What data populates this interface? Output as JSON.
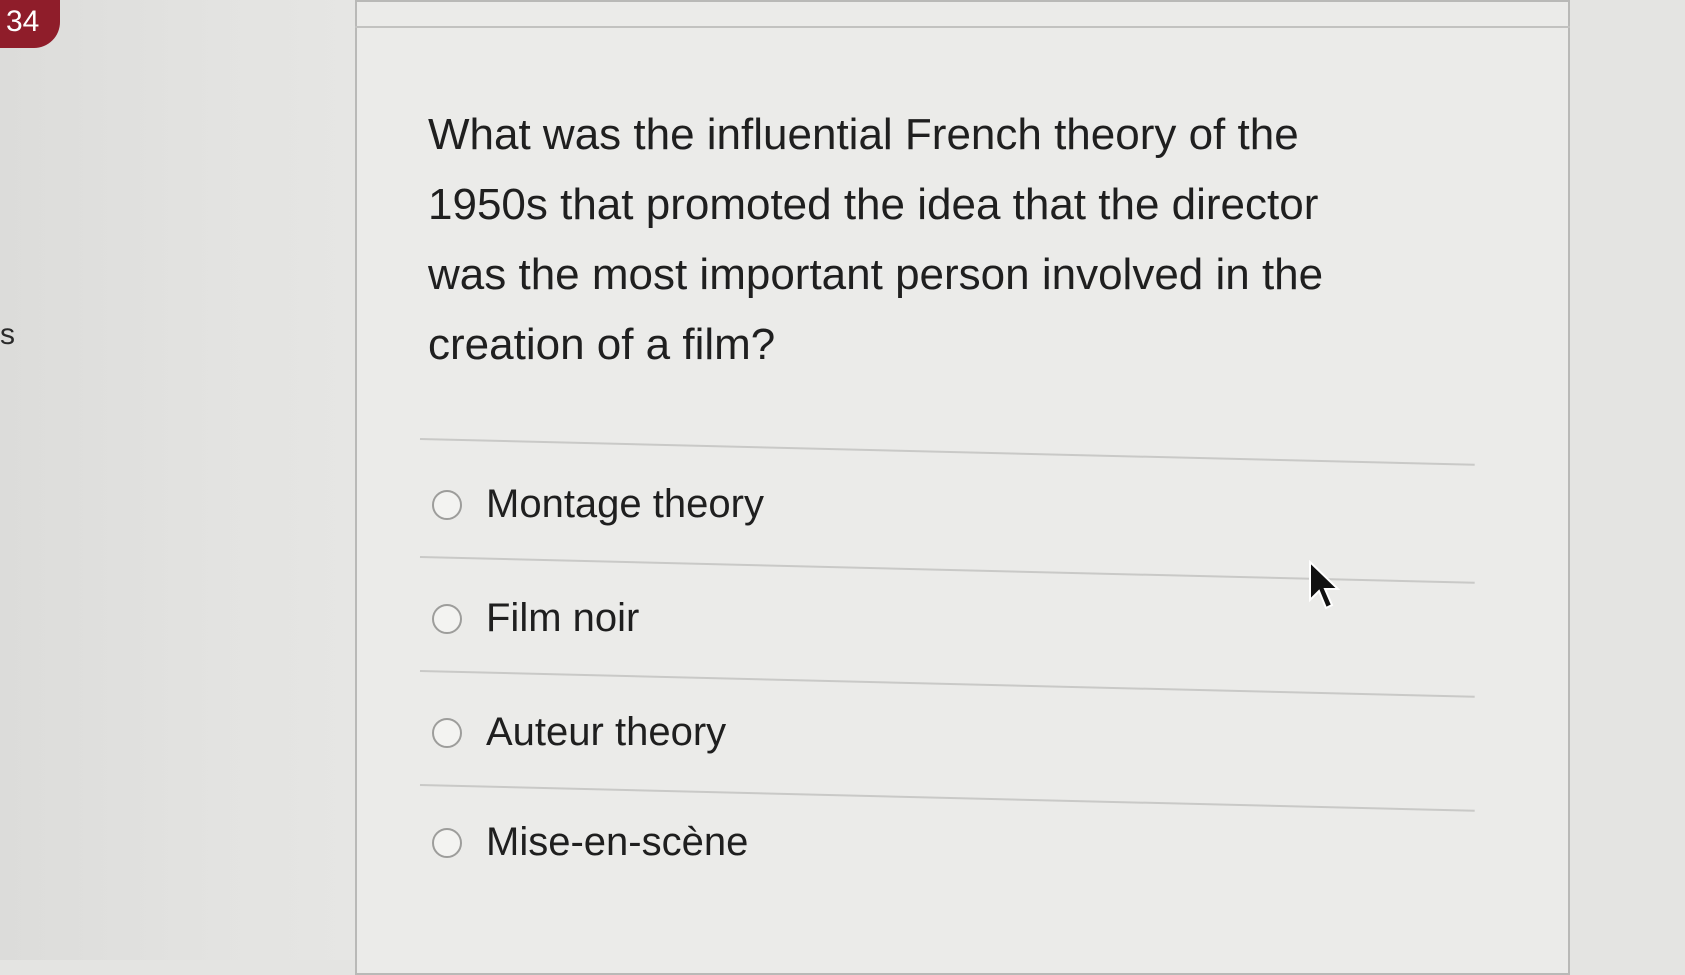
{
  "question_number": "34",
  "side_letter": "s",
  "question": {
    "text": "What was the influential French theory of the 1950s that promoted the idea that the director was the most important person involved in the creation of a film?"
  },
  "options": [
    {
      "label": "Montage theory",
      "selected": false
    },
    {
      "label": "Film noir",
      "selected": false
    },
    {
      "label": "Auteur theory",
      "selected": false
    },
    {
      "label": "Mise-en-scène",
      "selected": false
    }
  ],
  "icons": {
    "cursor": "mouse-pointer-icon",
    "radio": "radio-circle-icon"
  },
  "colors": {
    "badge": "#8f1d2a",
    "page_background": "#e4e4e2",
    "card_background": "#ebebe9",
    "text": "#1f1f1f"
  }
}
